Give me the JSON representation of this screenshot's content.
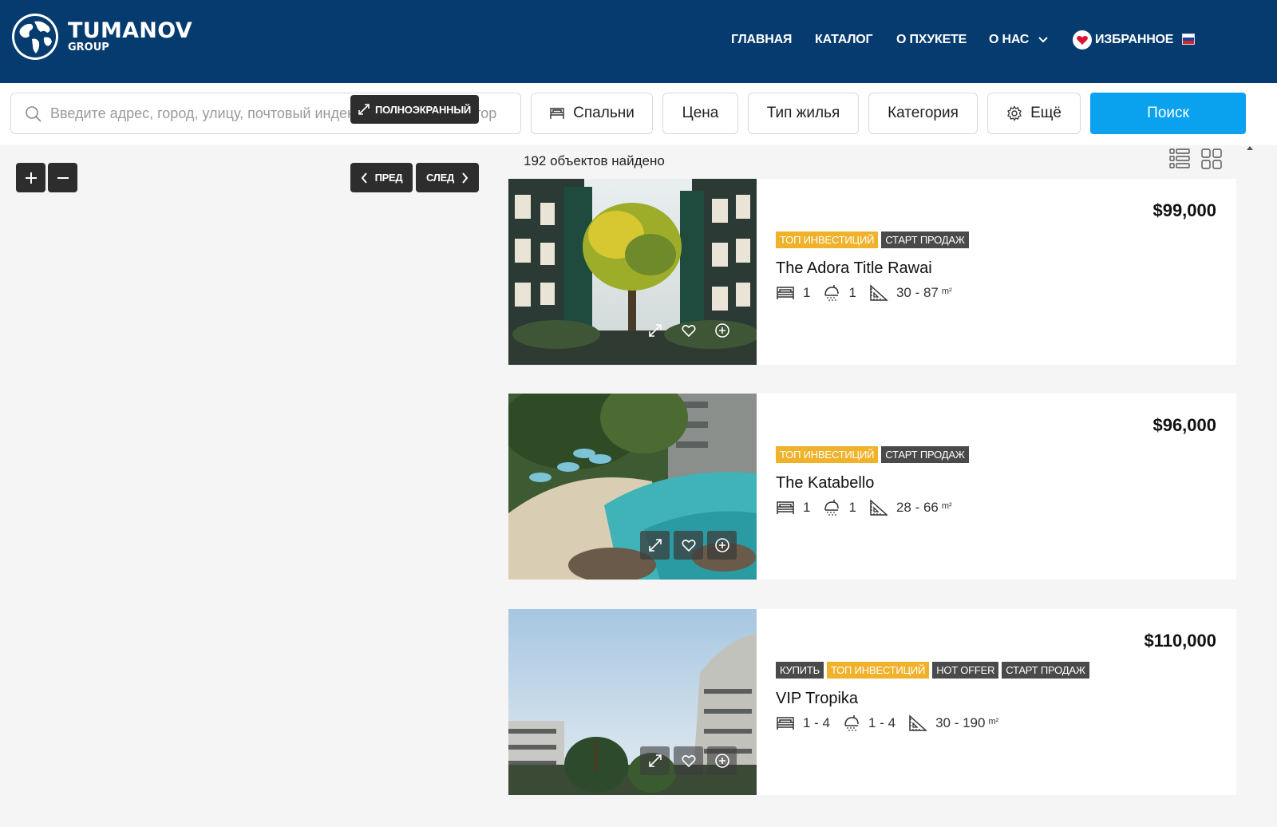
{
  "brand": {
    "name": "TUMANOV",
    "sub": "GROUP"
  },
  "nav": {
    "home": "ГЛАВНАЯ",
    "catalog": "КАТАЛОГ",
    "about_phuket": "О ПХУКЕТЕ",
    "about_us": "О НАС",
    "favorites": "ИЗБРАННОЕ"
  },
  "search": {
    "placeholder": "Введите адрес, город, улицу, почтовый индекс или идентификатор",
    "bedrooms": "Спальни",
    "price": "Цена",
    "type": "Тип жилья",
    "category": "Категория",
    "more": "Ещё",
    "submit": "Поиск"
  },
  "map": {
    "fullscreen": "ПОЛНОЭКРАННЫЙ",
    "prev": "ПРЕД",
    "next": "СЛЕД"
  },
  "results": {
    "count_text": "192 объектов найдено"
  },
  "listings": [
    {
      "price": "$99,000",
      "tags": [
        {
          "text": "ТОП ИНВЕСТИЦИЙ",
          "style": "gold"
        },
        {
          "text": "СТАРТ ПРОДАЖ",
          "style": "dark"
        }
      ],
      "title": "The Adora Title Rawai",
      "bedrooms": "1",
      "bathrooms": "1",
      "area": "30 - 87",
      "area_unit": "m²",
      "scene": "courtyard"
    },
    {
      "price": "$96,000",
      "tags": [
        {
          "text": "ТОП ИНВЕСТИЦИЙ",
          "style": "gold"
        },
        {
          "text": "СТАРТ ПРОДАЖ",
          "style": "dark"
        }
      ],
      "title": "The Katabello",
      "bedrooms": "1",
      "bathrooms": "1",
      "area": "28 - 66",
      "area_unit": "m²",
      "scene": "pool"
    },
    {
      "price": "$110,000",
      "tags": [
        {
          "text": "КУПИТЬ",
          "style": "dark"
        },
        {
          "text": "ТОП ИНВЕСТИЦИЙ",
          "style": "gold"
        },
        {
          "text": "HOT OFFER",
          "style": "dark"
        },
        {
          "text": "СТАРТ ПРОДАЖ",
          "style": "dark"
        }
      ],
      "title": "VIP Tropika",
      "bedrooms": "1 - 4",
      "bathrooms": "1 - 4",
      "area": "30 - 190",
      "area_unit": "m²",
      "scene": "sky"
    }
  ],
  "colors": {
    "header_bg": "#053b6e",
    "search_button": "#0aa1ee",
    "tag_gold": "#f0b22b",
    "tag_dark": "#4a4a4a",
    "control_dark": "#2d2d2d"
  }
}
